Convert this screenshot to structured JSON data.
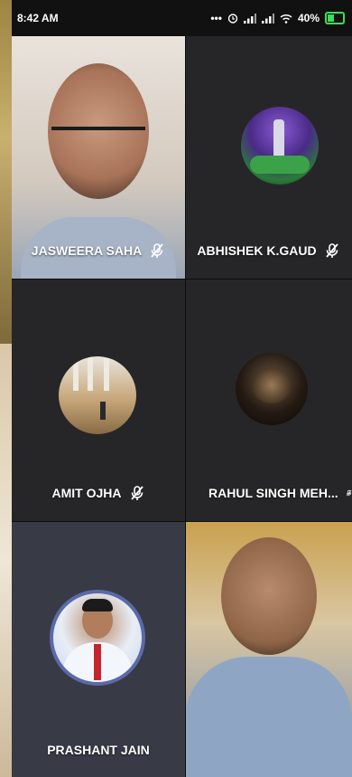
{
  "status_bar": {
    "time": "8:42 AM",
    "icons": [
      "more-dots-icon",
      "alarm-icon",
      "signal-icon",
      "signal-icon",
      "wifi-icon"
    ],
    "battery": "40%",
    "battery_color": "#3ddc5a"
  },
  "participants": [
    {
      "name": "JASWEERA SAHA",
      "muted": true,
      "video": true
    },
    {
      "name": "ABHISHEK K.GAUD",
      "muted": true,
      "video": false
    },
    {
      "name": "AMIT OJHA",
      "muted": true,
      "video": false
    },
    {
      "name": "RAHUL SINGH MEH...",
      "muted": true,
      "video": false
    },
    {
      "name": "PRASHANT JAIN",
      "muted": false,
      "video": false
    },
    {
      "name": "",
      "muted": false,
      "video": true
    }
  ]
}
